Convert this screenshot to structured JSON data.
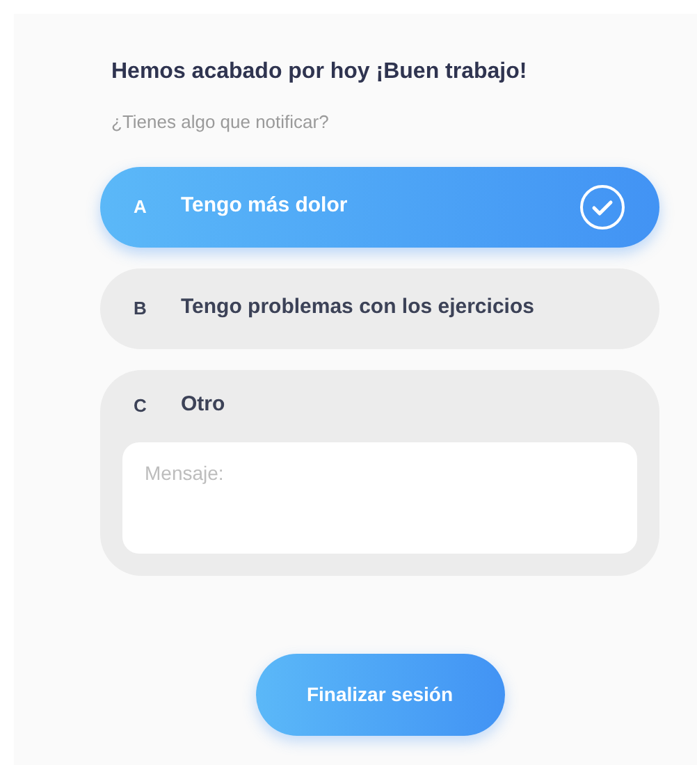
{
  "title": "Hemos acabado por hoy ¡Buen trabajo!",
  "subtitle": "¿Tienes algo que notificar?",
  "options": [
    {
      "kind": "choice",
      "letter": "A",
      "label": "Tengo más dolor",
      "selected": true
    },
    {
      "kind": "choice",
      "letter": "B",
      "label": "Tengo problemas con los ejercicios",
      "selected": false
    },
    {
      "kind": "text_entry",
      "letter": "C",
      "label": "Otro",
      "selected": false,
      "placeholder": "Mensaje:"
    }
  ],
  "finish_button": "Finalizar sesión"
}
